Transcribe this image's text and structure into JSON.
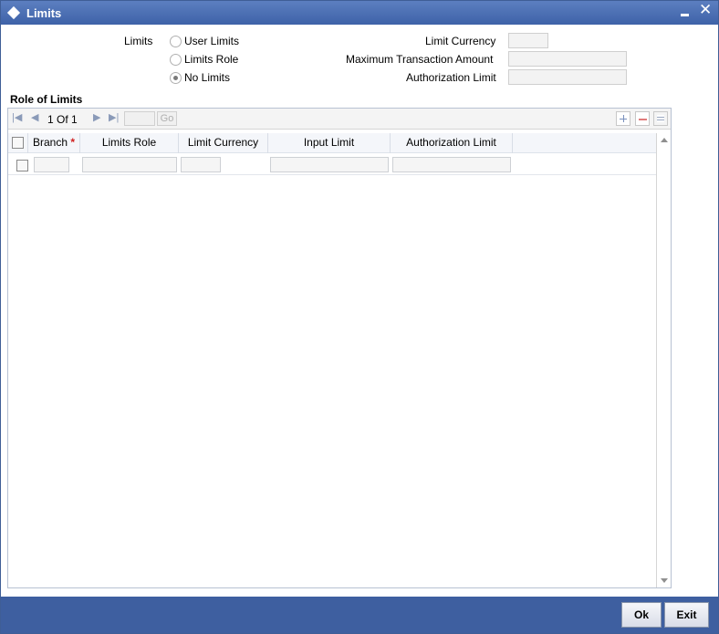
{
  "window": {
    "title": "Limits"
  },
  "limits_section": {
    "label": "Limits",
    "options": [
      {
        "label": "User Limits",
        "checked": false
      },
      {
        "label": "Limits Role",
        "checked": false
      },
      {
        "label": "No Limits",
        "checked": true
      }
    ],
    "limit_currency_label": "Limit Currency",
    "limit_currency_value": "",
    "max_txn_amount_label": "Maximum Transaction Amount",
    "max_txn_amount_value": "",
    "authorization_limit_label": "Authorization Limit",
    "authorization_limit_value": ""
  },
  "role_of_limits": {
    "title": "Role of Limits",
    "pagination": {
      "current": "1",
      "of_label": "Of",
      "total": "1",
      "go_label": "Go"
    },
    "columns": [
      "Branch",
      "Limits Role",
      "Limit Currency",
      "Input Limit",
      "Authorization Limit"
    ],
    "required_marker": "*",
    "rows": [
      {
        "branch": "",
        "limits_role": "",
        "limit_currency": "",
        "input_limit": "",
        "authorization_limit": ""
      }
    ]
  },
  "footer": {
    "ok_label": "Ok",
    "exit_label": "Exit"
  },
  "colors": {
    "titlebar": "#4a6db3",
    "footer": "#3e5fa0",
    "required": "#d02020"
  }
}
